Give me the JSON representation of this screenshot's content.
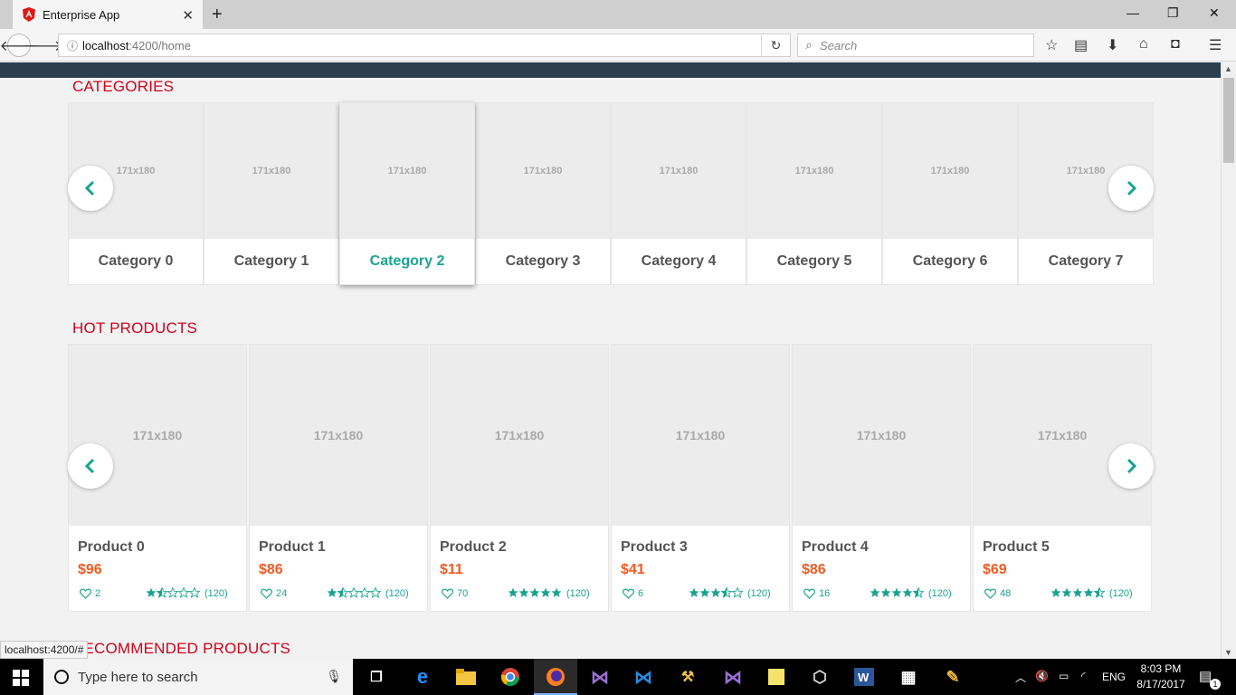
{
  "browser": {
    "tab_title": "Enterprise App",
    "url_host": "localhost",
    "url_path": ":4200/home",
    "search_placeholder": "Search",
    "status_url": "localhost:4200/#"
  },
  "sections": {
    "categories": "CATEGORIES",
    "hot_products": "HOT PRODUCTS",
    "recommended": "RECOMMENDED PRODUCTS"
  },
  "categories": [
    {
      "label": "Category 0",
      "img": "171x180"
    },
    {
      "label": "Category 1",
      "img": "171x180"
    },
    {
      "label": "Category 2",
      "img": "171x180",
      "active": true
    },
    {
      "label": "Category 3",
      "img": "171x180"
    },
    {
      "label": "Category 4",
      "img": "171x180"
    },
    {
      "label": "Category 5",
      "img": "171x180"
    },
    {
      "label": "Category 6",
      "img": "171x180"
    },
    {
      "label": "Category 7",
      "img": "171x180"
    }
  ],
  "products": [
    {
      "name": "Product 0",
      "price": "$96",
      "likes": "2",
      "rating": 1.5,
      "reviews": "(120)",
      "img": "171x180"
    },
    {
      "name": "Product 1",
      "price": "$86",
      "likes": "24",
      "rating": 1.5,
      "reviews": "(120)",
      "img": "171x180"
    },
    {
      "name": "Product 2",
      "price": "$11",
      "likes": "70",
      "rating": 5,
      "reviews": "(120)",
      "img": "171x180"
    },
    {
      "name": "Product 3",
      "price": "$41",
      "likes": "6",
      "rating": 3.5,
      "reviews": "(120)",
      "img": "171x180"
    },
    {
      "name": "Product 4",
      "price": "$86",
      "likes": "16",
      "rating": 4.5,
      "reviews": "(120)",
      "img": "171x180"
    },
    {
      "name": "Product 5",
      "price": "$69",
      "likes": "48",
      "rating": 4.5,
      "reviews": "(120)",
      "img": "171x180"
    }
  ],
  "taskbar": {
    "search_placeholder": "Type here to search",
    "language": "ENG",
    "time": "8:03 PM",
    "date": "8/17/2017",
    "notifications": "1"
  },
  "colors": {
    "accent": "#1aa391",
    "section_title": "#d0021b",
    "price": "#f15a22",
    "app_header": "#2d3e4f"
  }
}
